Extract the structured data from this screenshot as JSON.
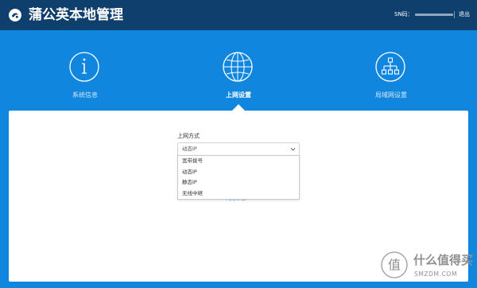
{
  "header": {
    "title": "蒲公英本地管理",
    "sn_label": "SN码：",
    "logout_label": "退出"
  },
  "nav": {
    "items": [
      {
        "label": "系统信息",
        "icon": "info-icon",
        "active": false
      },
      {
        "label": "上网设置",
        "icon": "globe-icon",
        "active": true
      },
      {
        "label": "局域网设置",
        "icon": "network-tree-icon",
        "active": false
      }
    ]
  },
  "form": {
    "internet_mode_label": "上网方式",
    "internet_mode_value": "动态IP",
    "options": [
      "宽带拨号",
      "动态IP",
      "静态IP",
      "无线中继"
    ],
    "help_link": "网络诊断>>"
  },
  "watermark": {
    "title": "什么值得买",
    "url": "SMZDM.COM"
  },
  "colors": {
    "header_bg": "#0f3f6c",
    "page_bg": "#1186df",
    "panel_bg": "#ffffff",
    "accent": "#1c86dc"
  }
}
